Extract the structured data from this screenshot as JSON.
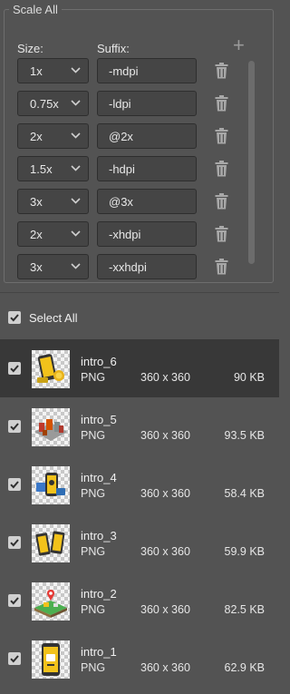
{
  "scale": {
    "legend": "Scale All",
    "size_label": "Size:",
    "suffix_label": "Suffix:",
    "rows": [
      {
        "size": "1x",
        "suffix": "-mdpi"
      },
      {
        "size": "0.75x",
        "suffix": "-ldpi"
      },
      {
        "size": "2x",
        "suffix": "@2x"
      },
      {
        "size": "1.5x",
        "suffix": "-hdpi"
      },
      {
        "size": "3x",
        "suffix": "@3x"
      },
      {
        "size": "2x",
        "suffix": "-xhdpi"
      },
      {
        "size": "3x",
        "suffix": "-xxhdpi"
      }
    ]
  },
  "select_all_label": "Select All",
  "assets": [
    {
      "name": "intro_6",
      "type": "PNG",
      "dims": "360 x 360",
      "size": "90 KB",
      "checked": true,
      "active": true
    },
    {
      "name": "intro_5",
      "type": "PNG",
      "dims": "360 x 360",
      "size": "93.5 KB",
      "checked": true
    },
    {
      "name": "intro_4",
      "type": "PNG",
      "dims": "360 x 360",
      "size": "58.4 KB",
      "checked": true
    },
    {
      "name": "intro_3",
      "type": "PNG",
      "dims": "360 x 360",
      "size": "59.9 KB",
      "checked": true
    },
    {
      "name": "intro_2",
      "type": "PNG",
      "dims": "360 x 360",
      "size": "82.5 KB",
      "checked": true
    },
    {
      "name": "intro_1",
      "type": "PNG",
      "dims": "360 x 360",
      "size": "62.9 KB",
      "checked": true
    }
  ],
  "colors": {
    "panel": "#535353",
    "active_row": "#383838",
    "field": "#454545"
  }
}
